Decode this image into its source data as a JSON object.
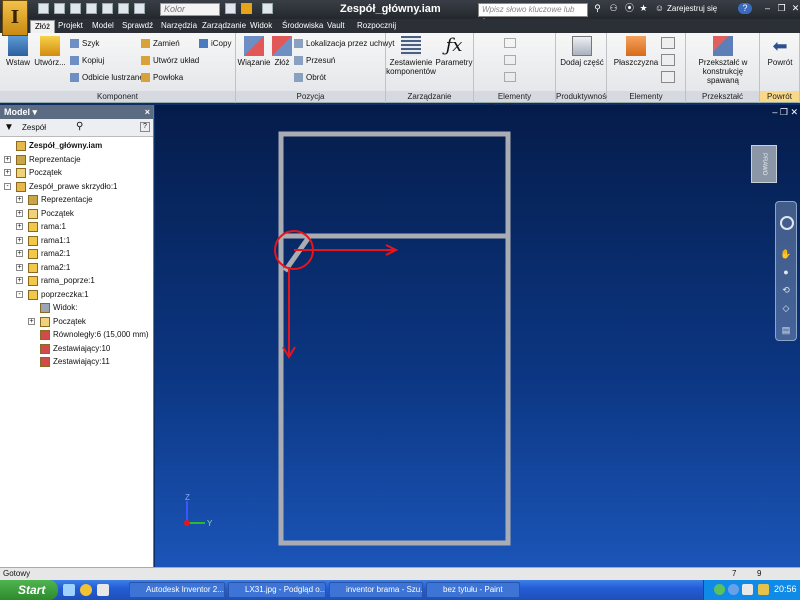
{
  "window": {
    "title": "Zespół_główny.iam",
    "app_letter": "I"
  },
  "quickaccess": {
    "color_placeholder": "Kolor"
  },
  "search": {
    "placeholder": "Wpisz słowo kluczowe lub frazę"
  },
  "user": {
    "label": "Zarejestruj się",
    "help": "?"
  },
  "menu_tabs": [
    "Złóż",
    "Projekt",
    "Model",
    "Sprawdź",
    "Narzędzia",
    "Zarządzanie",
    "Widok",
    "Środowiska",
    "Vault",
    "Rozpocznij"
  ],
  "ribbon": {
    "komponent": {
      "label": "Komponent",
      "wstaw": "Wstaw",
      "utworz": "Utwórz...",
      "szyk": "Szyk",
      "kopiuj": "Kopiuj",
      "odbicie": "Odbicie lustrzane",
      "zamien": "Zamień",
      "utworz_uklad": "Utwórz układ",
      "powloka": "Powłoka",
      "icopy": "iCopy"
    },
    "pozycja": {
      "label": "Pozycja",
      "wiazanie": "Wiązanie",
      "zloz": "Złóż",
      "lokalizacja": "Lokalizacja przez uchwyt",
      "przesun": "Przesuń",
      "obrot": "Obrót"
    },
    "zarzadzanie": {
      "label": "Zarządzanie",
      "zestawienie": "Zestawienie komponentów",
      "parametry": "Parametry"
    },
    "ipart": {
      "label": "Elementy iPart/iAssembly"
    },
    "produktywnosc": {
      "label": "Produktywność",
      "dodaj": "Dodaj część"
    },
    "konstrukcyjne": {
      "label": "Elementy konstrukcyjne",
      "plaszczyzna": "Płaszczyzna"
    },
    "przeksztalc": {
      "label": "Przekształć",
      "spawana": "Przekształć w konstrukcję spawaną"
    },
    "powrot": {
      "label": "Powrót",
      "btn": "Powrót"
    }
  },
  "browser": {
    "title": "Model",
    "filter": "Zespół",
    "items": [
      {
        "text": "Zespół_główny.iam",
        "level": 0,
        "exp": "",
        "icon": "assembly",
        "bold": true
      },
      {
        "text": "Reprezentacje",
        "level": 0,
        "exp": "+",
        "icon": "rep"
      },
      {
        "text": "Początek",
        "level": 0,
        "exp": "+",
        "icon": "folder"
      },
      {
        "text": "Zespół_prawe skrzydło:1",
        "level": 0,
        "exp": "-",
        "icon": "assembly"
      },
      {
        "text": "Reprezentacje",
        "level": 1,
        "exp": "+",
        "icon": "rep"
      },
      {
        "text": "Początek",
        "level": 1,
        "exp": "+",
        "icon": "folder"
      },
      {
        "text": "rama:1",
        "level": 1,
        "exp": "+",
        "icon": "part"
      },
      {
        "text": "rama1:1",
        "level": 1,
        "exp": "+",
        "icon": "part"
      },
      {
        "text": "rama2:1",
        "level": 1,
        "exp": "+",
        "icon": "part"
      },
      {
        "text": "rama2:1",
        "level": 1,
        "exp": "+",
        "icon": "part"
      },
      {
        "text": "rama_poprze:1",
        "level": 1,
        "exp": "+",
        "icon": "part"
      },
      {
        "text": "poprzeczka:1",
        "level": 1,
        "exp": "-",
        "icon": "part"
      },
      {
        "text": "Widok:",
        "level": 2,
        "exp": "",
        "icon": "view"
      },
      {
        "text": "Początek",
        "level": 2,
        "exp": "+",
        "icon": "folder"
      },
      {
        "text": "Równoległy:6 (15,000 mm)",
        "level": 2,
        "exp": "",
        "icon": "constraint"
      },
      {
        "text": "Zestawiający:10",
        "level": 2,
        "exp": "",
        "icon": "constraint"
      },
      {
        "text": "Zestawiający:11",
        "level": 2,
        "exp": "",
        "icon": "constraint"
      }
    ]
  },
  "viewport": {
    "viewcube_label": "PRAWO",
    "axis_x": "Y",
    "axis_y": "Z"
  },
  "status": {
    "left": "Gotowy",
    "n1": "7",
    "n2": "9"
  },
  "taskbar": {
    "start": "Start",
    "items": [
      "Autodesk Inventor 2...",
      "LX31.jpg - Podgląd o...",
      "inventor brama - Szu...",
      "bez tytułu - Paint"
    ],
    "clock": "20:56"
  },
  "colors": {
    "accent": "#f8d98a",
    "annotation": "#e8141c",
    "frame": "#a9adb3"
  }
}
